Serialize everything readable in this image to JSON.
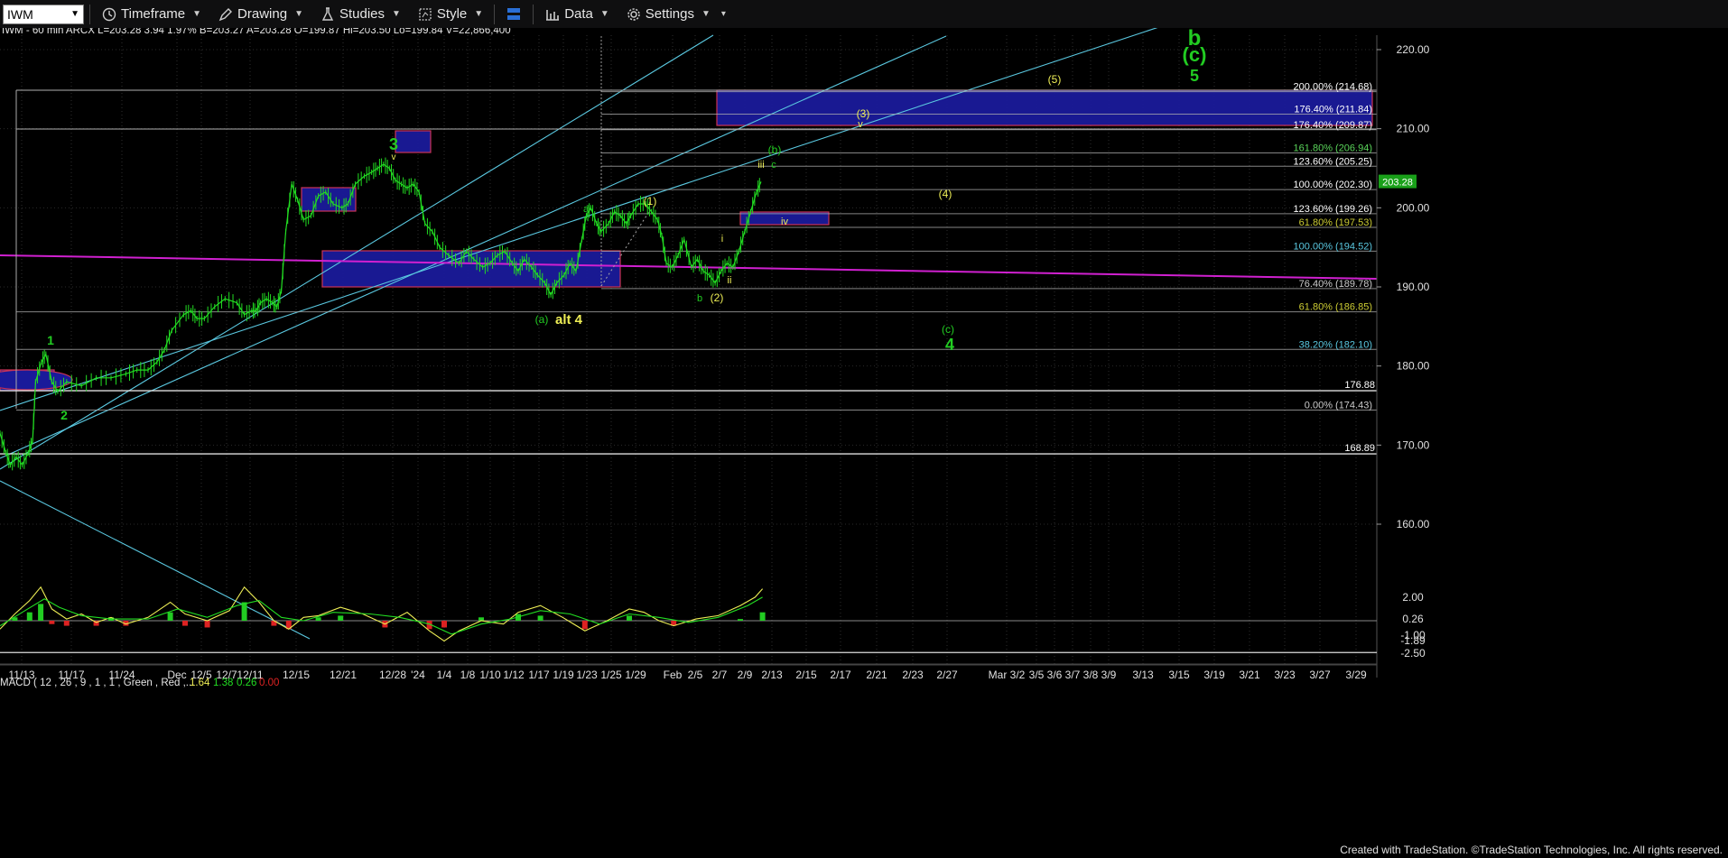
{
  "toolbar": {
    "symbol": "IWM",
    "items": [
      {
        "id": "timeframe",
        "label": "Timeframe",
        "icon": "clock-icon"
      },
      {
        "id": "drawing",
        "label": "Drawing",
        "icon": "pencil-icon"
      },
      {
        "id": "studies",
        "label": "Studies",
        "icon": "flask-icon"
      },
      {
        "id": "style",
        "label": "Style",
        "icon": "chart-style-icon"
      },
      {
        "id": "layout",
        "label": "",
        "icon": "layout-icon"
      },
      {
        "id": "data",
        "label": "Data",
        "icon": "bar-chart-icon"
      },
      {
        "id": "settings",
        "label": "Settings",
        "icon": "gear-icon"
      }
    ]
  },
  "header_text": "IWM - 60 min  ARCX  L=203.28  3.94  1.97%  B=203.27  A=203.28  O=199.87  Hi=203.50  Lo=199.84  V=22,866,400",
  "macd_text": "MACD ( 12 , 26 , 9 , 1 , 1 , Green , Red ,...",
  "macd_values": [
    "1.64",
    "1.38",
    "0.26",
    "0.00"
  ],
  "footer": "Created with TradeStation. ©TradeStation Technologies, Inc. All rights reserved.",
  "colors": {
    "price": "#22dd22",
    "green": "#22cc22",
    "yellow": "#eeee55",
    "cyan": "#5ac8e0",
    "magenta": "#d020d0",
    "blue_box": "#1a1a9a"
  },
  "chart_data": {
    "type": "line",
    "symbol": "IWM",
    "timeframe": "60 min",
    "y_ticks": [
      220,
      210,
      200,
      190,
      180,
      170,
      160
    ],
    "ylim": [
      154,
      222
    ],
    "last_price": "203.28",
    "x_ticks": [
      "11/13",
      "11/17",
      "11/24",
      "Dec",
      "12/5",
      "12/7",
      "12/11",
      "12/15",
      "12/21",
      "12/28",
      "'24",
      "1/4",
      "1/8",
      "1/10",
      "1/12",
      "1/17",
      "1/19",
      "1/23",
      "1/25",
      "1/29",
      "Feb",
      "2/5",
      "2/7",
      "2/9",
      "2/13",
      "2/15",
      "2/17",
      "2/21",
      "2/23",
      "2/27",
      "Mar 3/2",
      "3/5",
      "3/6",
      "3/7",
      "3/8",
      "3/9",
      "3/13",
      "3/15",
      "3/19",
      "3/21",
      "3/23",
      "3/27",
      "3/29"
    ],
    "price_series": [
      [
        0,
        171.5
      ],
      [
        8,
        169
      ],
      [
        14,
        167.5
      ],
      [
        22,
        168.5
      ],
      [
        30,
        167.5
      ],
      [
        38,
        169
      ],
      [
        44,
        170.5
      ],
      [
        48,
        178
      ],
      [
        56,
        180.5
      ],
      [
        62,
        181.5
      ],
      [
        70,
        178
      ],
      [
        78,
        176.8
      ],
      [
        90,
        178
      ],
      [
        110,
        177.5
      ],
      [
        130,
        178.5
      ],
      [
        150,
        178.5
      ],
      [
        170,
        179
      ],
      [
        185,
        179.5
      ],
      [
        200,
        179.5
      ],
      [
        212,
        180.5
      ],
      [
        222,
        182
      ],
      [
        232,
        184.5
      ],
      [
        248,
        186.5
      ],
      [
        258,
        187
      ],
      [
        266,
        186
      ],
      [
        276,
        186
      ],
      [
        290,
        187.5
      ],
      [
        304,
        188.5
      ],
      [
        320,
        188
      ],
      [
        330,
        186.5
      ],
      [
        340,
        187
      ],
      [
        346,
        187
      ],
      [
        352,
        188
      ],
      [
        360,
        188.5
      ],
      [
        368,
        188
      ],
      [
        374,
        187.5
      ],
      [
        380,
        189.5
      ],
      [
        386,
        197
      ],
      [
        394,
        203
      ],
      [
        402,
        201
      ],
      [
        410,
        198.5
      ],
      [
        420,
        199
      ],
      [
        430,
        201.5
      ],
      [
        440,
        202
      ],
      [
        450,
        200.5
      ],
      [
        462,
        200
      ],
      [
        470,
        200.5
      ],
      [
        480,
        203
      ],
      [
        492,
        204
      ],
      [
        502,
        204.5
      ],
      [
        510,
        205
      ],
      [
        518,
        205.5
      ],
      [
        526,
        205
      ],
      [
        534,
        203.5
      ],
      [
        542,
        203
      ],
      [
        550,
        202.5
      ],
      [
        558,
        203
      ],
      [
        566,
        202
      ],
      [
        574,
        198
      ],
      [
        584,
        197
      ],
      [
        594,
        195
      ],
      [
        606,
        194
      ],
      [
        620,
        193
      ],
      [
        630,
        194.5
      ],
      [
        640,
        193.5
      ],
      [
        652,
        192.5
      ],
      [
        662,
        193
      ],
      [
        672,
        194
      ],
      [
        682,
        194.5
      ],
      [
        692,
        193
      ],
      [
        700,
        192
      ],
      [
        708,
        193.5
      ],
      [
        718,
        192.5
      ],
      [
        726,
        191.5
      ],
      [
        736,
        190.5
      ],
      [
        744,
        189
      ],
      [
        752,
        190.5
      ],
      [
        762,
        191.5
      ],
      [
        770,
        193
      ],
      [
        778,
        192
      ],
      [
        786,
        196
      ],
      [
        792,
        199
      ],
      [
        798,
        200
      ],
      [
        806,
        198
      ],
      [
        812,
        197
      ],
      [
        822,
        198
      ],
      [
        830,
        199.5
      ],
      [
        838,
        199
      ],
      [
        846,
        198
      ],
      [
        852,
        199
      ],
      [
        862,
        200.5
      ],
      [
        872,
        200.5
      ],
      [
        880,
        199.5
      ],
      [
        888,
        198.5
      ],
      [
        894,
        196.5
      ],
      [
        900,
        193
      ],
      [
        908,
        192.5
      ],
      [
        916,
        194
      ],
      [
        924,
        196
      ],
      [
        934,
        192.5
      ],
      [
        942,
        193.5
      ],
      [
        950,
        192
      ],
      [
        958,
        191.5
      ],
      [
        966,
        190.5
      ],
      [
        974,
        192
      ],
      [
        982,
        193
      ],
      [
        990,
        192.5
      ],
      [
        998,
        194.5
      ],
      [
        1006,
        197
      ],
      [
        1014,
        199.5
      ],
      [
        1022,
        202
      ],
      [
        1028,
        203.3
      ]
    ],
    "macd_series": {
      "macd": [
        [
          0,
          -0.5
        ],
        [
          20,
          0.4
        ],
        [
          40,
          1.2
        ],
        [
          55,
          2.0
        ],
        [
          70,
          0.7
        ],
        [
          90,
          0.1
        ],
        [
          110,
          0.4
        ],
        [
          130,
          -0.1
        ],
        [
          150,
          0.2
        ],
        [
          170,
          -0.2
        ],
        [
          200,
          0.2
        ],
        [
          230,
          1.1
        ],
        [
          250,
          0.4
        ],
        [
          280,
          0.0
        ],
        [
          310,
          0.6
        ],
        [
          330,
          2.0
        ],
        [
          350,
          1.1
        ],
        [
          370,
          0.0
        ],
        [
          390,
          -0.5
        ],
        [
          410,
          0.2
        ],
        [
          430,
          0.3
        ],
        [
          460,
          0.8
        ],
        [
          490,
          0.4
        ],
        [
          520,
          -0.2
        ],
        [
          550,
          0.5
        ],
        [
          580,
          -0.6
        ],
        [
          600,
          -1.2
        ],
        [
          620,
          -0.6
        ],
        [
          650,
          0.0
        ],
        [
          680,
          -0.2
        ],
        [
          700,
          0.5
        ],
        [
          730,
          0.9
        ],
        [
          760,
          0.2
        ],
        [
          790,
          -0.6
        ],
        [
          820,
          0.0
        ],
        [
          850,
          0.7
        ],
        [
          870,
          0.5
        ],
        [
          890,
          0.0
        ],
        [
          910,
          -0.3
        ],
        [
          940,
          0.1
        ],
        [
          970,
          0.3
        ],
        [
          1000,
          0.9
        ],
        [
          1020,
          1.4
        ],
        [
          1030,
          1.9
        ]
      ],
      "signal": [
        [
          0,
          -0.3
        ],
        [
          30,
          0.5
        ],
        [
          60,
          1.3
        ],
        [
          80,
          0.8
        ],
        [
          110,
          0.3
        ],
        [
          150,
          0.1
        ],
        [
          200,
          0.1
        ],
        [
          240,
          0.7
        ],
        [
          280,
          0.2
        ],
        [
          320,
          0.9
        ],
        [
          350,
          1.2
        ],
        [
          380,
          0.2
        ],
        [
          410,
          0.0
        ],
        [
          450,
          0.5
        ],
        [
          500,
          0.4
        ],
        [
          540,
          0.2
        ],
        [
          580,
          -0.2
        ],
        [
          610,
          -0.8
        ],
        [
          650,
          -0.2
        ],
        [
          690,
          0.1
        ],
        [
          730,
          0.6
        ],
        [
          770,
          0.4
        ],
        [
          810,
          -0.2
        ],
        [
          850,
          0.4
        ],
        [
          890,
          0.2
        ],
        [
          930,
          -0.1
        ],
        [
          970,
          0.2
        ],
        [
          1010,
          0.9
        ],
        [
          1030,
          1.4
        ]
      ],
      "hist": [
        [
          20,
          0.2
        ],
        [
          40,
          0.5
        ],
        [
          55,
          1.0
        ],
        [
          70,
          -0.2
        ],
        [
          90,
          -0.3
        ],
        [
          130,
          -0.3
        ],
        [
          150,
          0.2
        ],
        [
          170,
          -0.3
        ],
        [
          230,
          0.5
        ],
        [
          250,
          -0.3
        ],
        [
          280,
          -0.4
        ],
        [
          330,
          1.1
        ],
        [
          350,
          0.0
        ],
        [
          370,
          -0.3
        ],
        [
          390,
          -0.5
        ],
        [
          430,
          0.2
        ],
        [
          460,
          0.3
        ],
        [
          520,
          -0.4
        ],
        [
          580,
          -0.5
        ],
        [
          600,
          -0.4
        ],
        [
          650,
          0.2
        ],
        [
          700,
          0.4
        ],
        [
          730,
          0.3
        ],
        [
          790,
          -0.5
        ],
        [
          850,
          0.3
        ],
        [
          910,
          -0.3
        ],
        [
          1000,
          0.1
        ],
        [
          1030,
          0.5
        ]
      ],
      "y_ticks": [
        "2.00",
        "0.26",
        "-1.00",
        "-1.89",
        "-2.50"
      ]
    },
    "fib_levels": [
      {
        "label": "200.00% (214.68)",
        "value": 214.68,
        "color": "#ffffff"
      },
      {
        "label": "176.40% (211.84)",
        "value": 211.84,
        "color": "#ffffff"
      },
      {
        "label": "176.40% (209.87)",
        "value": 209.87,
        "color": "#ffffff"
      },
      {
        "label": "161.80% (206.94)",
        "value": 206.94,
        "color": "#5ad55a"
      },
      {
        "label": "123.60% (205.25)",
        "value": 205.25,
        "color": "#ffffff"
      },
      {
        "label": "100.00% (202.30)",
        "value": 202.3,
        "color": "#ffffff"
      },
      {
        "label": "123.60% (199.26)",
        "value": 199.26,
        "color": "#ffffff"
      },
      {
        "label": "61.80% (197.53)",
        "value": 197.53,
        "color": "#cccc33"
      },
      {
        "label": "100.00% (194.52)",
        "value": 194.52,
        "color": "#5ac8e0"
      },
      {
        "label": "76.40% (189.78)",
        "value": 189.78,
        "color": "#cccccc"
      },
      {
        "label": "61.80% (186.85)",
        "value": 186.85,
        "color": "#cccc33"
      },
      {
        "label": "38.20% (182.10)",
        "value": 182.1,
        "color": "#5ac8e0"
      },
      {
        "label": "0.00% (174.43)",
        "value": 174.43,
        "color": "#cccccc"
      }
    ],
    "price_labels": [
      {
        "label": "176.88",
        "value": 176.88
      },
      {
        "label": "168.89",
        "value": 168.89
      }
    ],
    "wave_labels": [
      {
        "text": "b",
        "x": 1323,
        "y": 46,
        "color": "#22cc22",
        "size": 24,
        "bold": true
      },
      {
        "text": "(c)",
        "x": 1323,
        "y": 64,
        "color": "#22cc22",
        "size": 22,
        "bold": true
      },
      {
        "text": "5",
        "x": 1323,
        "y": 86,
        "color": "#22cc22",
        "size": 18,
        "bold": true
      },
      {
        "text": "(5)",
        "x": 1168,
        "y": 88,
        "color": "#eeee55",
        "size": 12
      },
      {
        "text": "(3)",
        "x": 956,
        "y": 126,
        "color": "#eeee55",
        "size": 12
      },
      {
        "text": "v",
        "x": 953,
        "y": 137,
        "color": "#eeee55",
        "size": 11
      },
      {
        "text": "(b)",
        "x": 858,
        "y": 166,
        "color": "#22cc22",
        "size": 12
      },
      {
        "text": "iii",
        "x": 843,
        "y": 182,
        "color": "#eeee55",
        "size": 11
      },
      {
        "text": "c",
        "x": 857,
        "y": 182,
        "color": "#22cc22",
        "size": 11
      },
      {
        "text": "(4)",
        "x": 1047,
        "y": 215,
        "color": "#eeee55",
        "size": 12
      },
      {
        "text": "iv",
        "x": 869,
        "y": 245,
        "color": "#eeee55",
        "size": 11
      },
      {
        "text": "3",
        "x": 436,
        "y": 162,
        "color": "#22cc22",
        "size": 18,
        "bold": true
      },
      {
        "text": "v",
        "x": 436,
        "y": 173,
        "color": "#eeee55",
        "size": 10
      },
      {
        "text": "a",
        "x": 649,
        "y": 231,
        "color": "#22cc22",
        "size": 11
      },
      {
        "text": "(1)",
        "x": 720,
        "y": 223,
        "color": "#eeee55",
        "size": 12
      },
      {
        "text": "i",
        "x": 800,
        "y": 264,
        "color": "#eeee55",
        "size": 11
      },
      {
        "text": "ii",
        "x": 808,
        "y": 310,
        "color": "#eeee55",
        "size": 11
      },
      {
        "text": "b",
        "x": 775,
        "y": 330,
        "color": "#22cc22",
        "size": 11
      },
      {
        "text": "(2)",
        "x": 794,
        "y": 330,
        "color": "#eeee55",
        "size": 12
      },
      {
        "text": "(a)",
        "x": 600,
        "y": 354,
        "color": "#22cc22",
        "size": 12
      },
      {
        "text": "alt 4",
        "x": 630,
        "y": 355,
        "color": "#eeee55",
        "size": 15,
        "bold": true
      },
      {
        "text": "(c)",
        "x": 1050,
        "y": 365,
        "color": "#22cc22",
        "size": 12
      },
      {
        "text": "4",
        "x": 1052,
        "y": 384,
        "color": "#22cc22",
        "size": 18,
        "bold": true
      },
      {
        "text": "1",
        "x": 56,
        "y": 378,
        "color": "#22cc22",
        "size": 14,
        "bold": true
      },
      {
        "text": "2",
        "x": 71,
        "y": 461,
        "color": "#22cc22",
        "size": 14,
        "bold": true
      }
    ]
  }
}
